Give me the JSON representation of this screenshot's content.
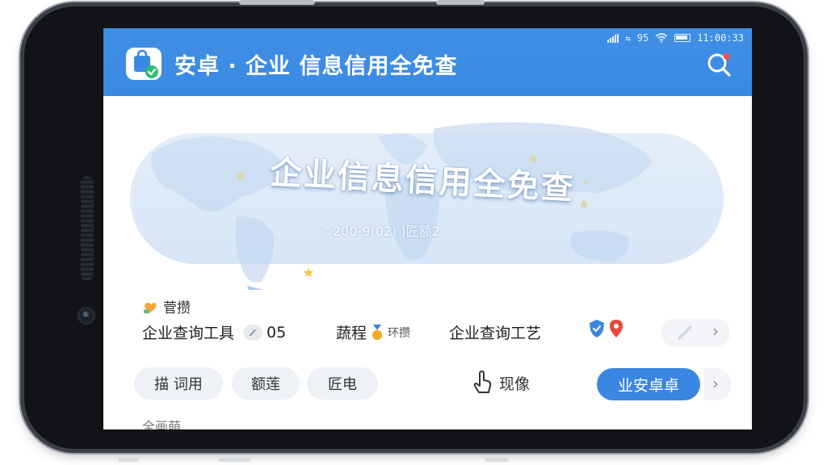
{
  "status_bar": {
    "network": "95",
    "time": "11:00:33"
  },
  "app_bar": {
    "title": "安卓 · 企业 信息信用全免查",
    "logo_icon": "shopping-bag-check-icon",
    "search_icon": "search-icon"
  },
  "banner": {
    "title": "企业信息信用全免查",
    "subtitle": "©200-9(02) )匠额2"
  },
  "info_section": {
    "label": "菅攒",
    "row1": {
      "tool_label": "企业查询工具",
      "tool_count": "05",
      "item2_label": "蔬程",
      "item2_small": "环攒",
      "item3_label": "企业查询工艺"
    },
    "row2": {
      "chip1": "描  词用",
      "chip2": "额莲",
      "chip3": "匠电",
      "gesture_label": "现像",
      "primary_button": "业安卓卓"
    },
    "footer_label": "全画萌"
  },
  "colors": {
    "primary_blue": "#3a8ae3",
    "button_blue": "#3a86e0",
    "chip_gray": "#eef1f5"
  }
}
